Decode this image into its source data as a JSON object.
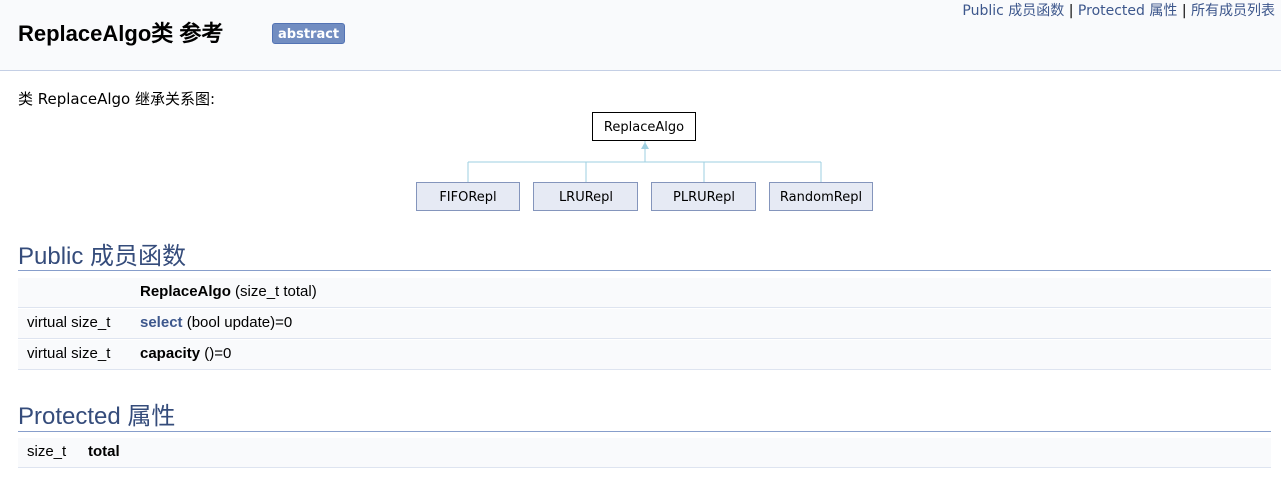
{
  "nav": {
    "public_funcs": "Public 成员函数",
    "sep1": " | ",
    "protected_attrs": "Protected 属性",
    "sep2": " | ",
    "all_members": "所有成员列表"
  },
  "title": "ReplaceAlgo类 参考",
  "badge": "abstract",
  "inherit_label": "类 ReplaceAlgo 继承关系图:",
  "graph": {
    "base": "ReplaceAlgo",
    "derived": [
      "FIFORepl",
      "LRURepl",
      "PLRURepl",
      "RandomRepl"
    ]
  },
  "public_section": {
    "heading": "Public 成员函数",
    "rows": [
      {
        "type": "",
        "name": "ReplaceAlgo",
        "args": " (size_t total)",
        "link": false
      },
      {
        "type": "virtual size_t",
        "name": "select",
        "args": " (bool update)=0",
        "link": true
      },
      {
        "type": "virtual size_t",
        "name": "capacity",
        "args": " ()=0",
        "link": false
      }
    ]
  },
  "protected_section": {
    "heading": "Protected 属性",
    "rows": [
      {
        "type": "size_t",
        "name": "total"
      }
    ]
  }
}
